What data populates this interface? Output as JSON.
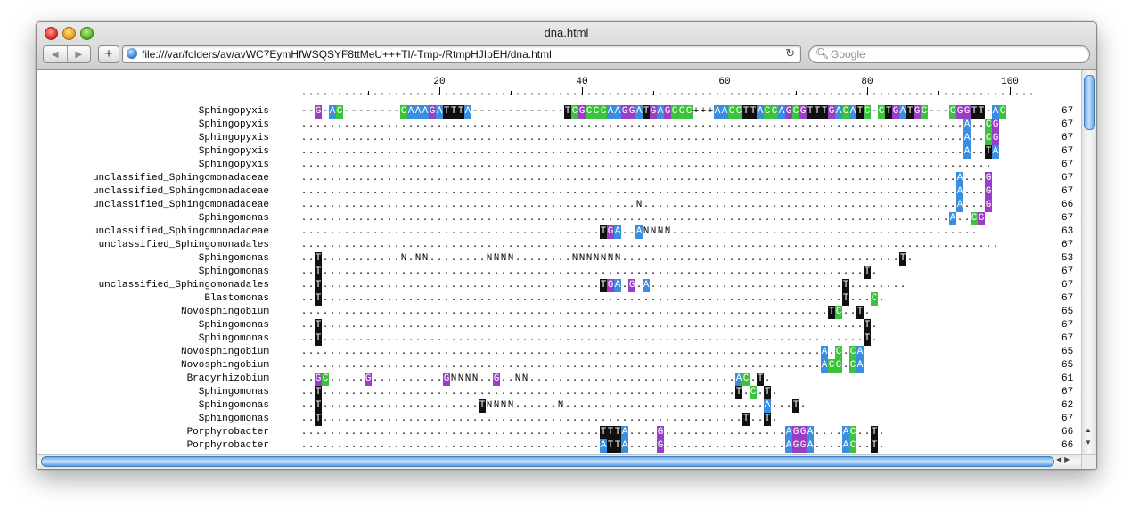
{
  "window": {
    "title": "dna.html"
  },
  "toolbar": {
    "back_icon": "back-arrow-icon",
    "forward_icon": "forward-arrow-icon",
    "add_label": "+",
    "url": "file:///var/folders/av/avWC7EymHfWSQSYF8ttMeU+++TI/-Tmp-/RtmpHJIpEH/dna.html",
    "search_placeholder": "Google"
  },
  "alignment": {
    "ruler_labels": [
      "20",
      "40",
      "60",
      "80",
      "100"
    ],
    "rows": [
      {
        "name": "Sphingopyxis",
        "seq": "--G-AC--------CAAAGATTTA-------------TCGCCCAAGGATGAGCCC+++AACCTTACCAGCGTTTGACATC-CTGATGC---CGGTT-AC",
        "length": "67",
        "colored": true
      },
      {
        "name": "Sphingopyxis",
        "seq": ".............................................................................................A..CG",
        "length": "67",
        "colored": false
      },
      {
        "name": "Sphingopyxis",
        "seq": ".............................................................................................A..CG",
        "length": "67",
        "colored": false
      },
      {
        "name": "Sphingopyxis",
        "seq": ".............................................................................................A..TA",
        "length": "67",
        "colored": false
      },
      {
        "name": "Sphingopyxis",
        "seq": ".................................................................................................",
        "length": "67",
        "colored": false
      },
      {
        "name": "unclassified_Sphingomonadaceae",
        "seq": "............................................................................................A...G",
        "length": "67",
        "colored": false
      },
      {
        "name": "unclassified_Sphingomonadaceae",
        "seq": "............................................................................................A...G",
        "length": "67",
        "colored": false
      },
      {
        "name": "unclassified_Sphingomonadaceae",
        "seq": "...............................................N............................................A...G",
        "length": "66",
        "colored": false
      },
      {
        "name": "Sphingomonas",
        "seq": "...........................................................................................A..CG",
        "length": "67",
        "colored": false
      },
      {
        "name": "unclassified_Sphingomonadaceae",
        "seq": "..........................................TGA..ANNNN...........................................",
        "length": "63",
        "colored": false
      },
      {
        "name": "unclassified_Sphingomonadales",
        "seq": "..................................................................................................",
        "length": "67",
        "colored": false
      },
      {
        "name": "Sphingomonas",
        "seq": "..T...........N.NN........NNNN........NNNNNNN.......................................T.",
        "length": "53",
        "colored": false
      },
      {
        "name": "Sphingomonas",
        "seq": "..T............................................................................T.",
        "length": "67",
        "colored": false
      },
      {
        "name": "unclassified_Sphingomonadales",
        "seq": "..T.......................................TGA.G.A...........................T........",
        "length": "67",
        "colored": false
      },
      {
        "name": "Blastomonas",
        "seq": "..T.........................................................................T...C.",
        "length": "67",
        "colored": false
      },
      {
        "name": "Novosphingobium",
        "seq": "..........................................................................TC..T.",
        "length": "65",
        "colored": false
      },
      {
        "name": "Sphingomonas",
        "seq": "..T............................................................................T.",
        "length": "67",
        "colored": false
      },
      {
        "name": "Sphingomonas",
        "seq": "..T............................................................................T.",
        "length": "67",
        "colored": false
      },
      {
        "name": "Novosphingobium",
        "seq": ".........................................................................A.C.CA",
        "length": "65",
        "colored": false
      },
      {
        "name": "Novosphingobium",
        "seq": ".........................................................................ACC.CA",
        "length": "65",
        "colored": false
      },
      {
        "name": "Bradyrhizobium",
        "seq": "..GC.....G..........GNNNN..G..NN.............................AC.T.",
        "length": "61",
        "colored": false
      },
      {
        "name": "Sphingomonas",
        "seq": "..T..........................................................T.C.T.",
        "length": "67",
        "colored": false
      },
      {
        "name": "Sphingomonas",
        "seq": "..T......................TNNNN......N............................A...T.",
        "length": "62",
        "colored": false
      },
      {
        "name": "Sphingomonas",
        "seq": "..T...........................................................T..T.",
        "length": "67",
        "colored": false
      },
      {
        "name": "Porphyrobacter",
        "seq": "..........................................TTTA....G.................AGGA....AC..T.",
        "length": "66",
        "colored": false
      },
      {
        "name": "Porphyrobacter",
        "seq": "..........................................ATTA....G.................AGGA....AC..T.",
        "length": "66",
        "colored": false
      }
    ]
  },
  "colors": {
    "G": "#9a3ec8",
    "A": "#3a8ee0",
    "C": "#3cc23c",
    "T": "#101010"
  }
}
